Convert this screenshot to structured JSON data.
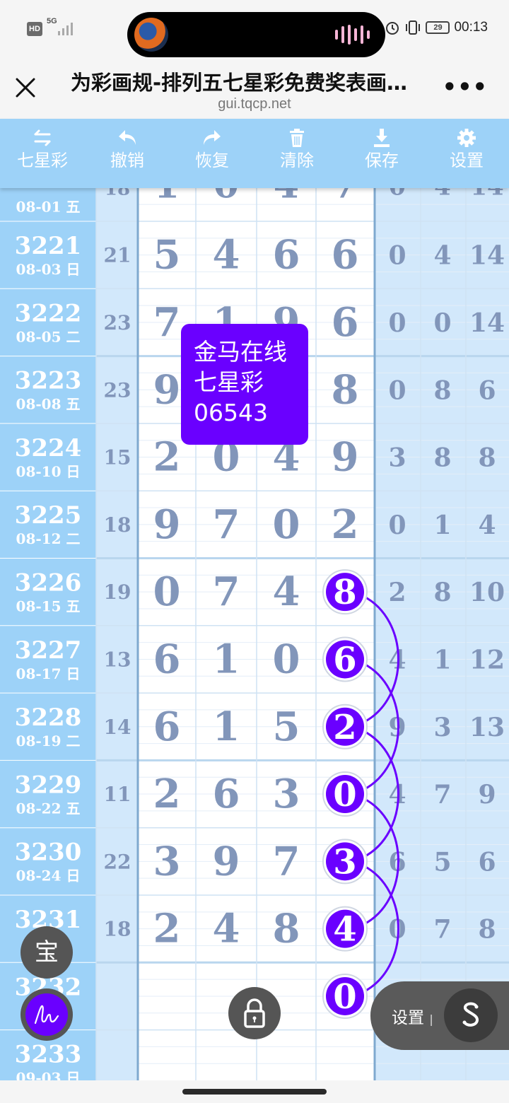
{
  "status_bar": {
    "network_badge": "HD",
    "network_type": "5G",
    "battery": "29",
    "time": "00:13"
  },
  "title_bar": {
    "title": "为彩画规-排列五七星彩免费奖表画…",
    "url": "gui.tqcp.net",
    "more": "•••"
  },
  "toolbar": [
    {
      "label": "七星彩",
      "icon": "swap-icon"
    },
    {
      "label": "撤销",
      "icon": "undo-icon"
    },
    {
      "label": "恢复",
      "icon": "redo-icon"
    },
    {
      "label": "清除",
      "icon": "trash-icon"
    },
    {
      "label": "保存",
      "icon": "download-icon"
    },
    {
      "label": "设置",
      "icon": "gear-icon"
    }
  ],
  "grid": {
    "partial_top": {
      "date": "08-01 五",
      "sum": "18",
      "digits": [
        "1",
        "0",
        "4",
        "7"
      ],
      "right": [
        "0",
        "4",
        "14"
      ]
    },
    "rows": [
      {
        "issue": "3221",
        "date": "08-03 日",
        "sum": "21",
        "digits": [
          "5",
          "4",
          "6",
          "6"
        ],
        "right": [
          "0",
          "4",
          "14"
        ]
      },
      {
        "issue": "3222",
        "date": "08-05 二",
        "sum": "23",
        "digits": [
          "7",
          "1",
          "9",
          "6"
        ],
        "right": [
          "0",
          "0",
          "14"
        ]
      },
      {
        "issue": "3223",
        "date": "08-08 五",
        "sum": "23",
        "digits": [
          "9",
          "",
          "",
          "8"
        ],
        "right": [
          "0",
          "8",
          "6"
        ]
      },
      {
        "issue": "3224",
        "date": "08-10 日",
        "sum": "15",
        "digits": [
          "2",
          "0",
          "4",
          "9"
        ],
        "right": [
          "3",
          "8",
          "8"
        ]
      },
      {
        "issue": "3225",
        "date": "08-12 二",
        "sum": "18",
        "digits": [
          "9",
          "7",
          "0",
          "2"
        ],
        "right": [
          "0",
          "1",
          "4"
        ]
      },
      {
        "issue": "3226",
        "date": "08-15 五",
        "sum": "19",
        "digits": [
          "0",
          "7",
          "4",
          "8"
        ],
        "right": [
          "2",
          "8",
          "10"
        ]
      },
      {
        "issue": "3227",
        "date": "08-17 日",
        "sum": "13",
        "digits": [
          "6",
          "1",
          "0",
          "6"
        ],
        "right": [
          "4",
          "1",
          "12"
        ]
      },
      {
        "issue": "3228",
        "date": "08-19 二",
        "sum": "14",
        "digits": [
          "6",
          "1",
          "5",
          "2"
        ],
        "right": [
          "9",
          "3",
          "13"
        ]
      },
      {
        "issue": "3229",
        "date": "08-22 五",
        "sum": "11",
        "digits": [
          "2",
          "6",
          "3",
          "0"
        ],
        "right": [
          "4",
          "7",
          "9"
        ]
      },
      {
        "issue": "3230",
        "date": "08-24 日",
        "sum": "22",
        "digits": [
          "3",
          "9",
          "7",
          "3"
        ],
        "right": [
          "6",
          "5",
          "6"
        ]
      },
      {
        "issue": "3231",
        "date": "",
        "sum": "18",
        "digits": [
          "2",
          "4",
          "8",
          "4"
        ],
        "right": [
          "0",
          "7",
          "8"
        ]
      },
      {
        "issue": "3232",
        "date": "",
        "sum": "",
        "digits": [
          "",
          "",
          "",
          "0"
        ],
        "right": [
          "",
          "",
          ""
        ]
      },
      {
        "issue": "3233",
        "date": "09-03 日",
        "sum": "",
        "digits": [
          "",
          "",
          "",
          ""
        ],
        "right": [
          "",
          "",
          ""
        ]
      }
    ],
    "highlighted_column": 3,
    "highlighted_rows": [
      5,
      6,
      7,
      8,
      9,
      10,
      11
    ]
  },
  "popup": {
    "line1": "金马在线",
    "line2": "七星彩",
    "line3": "06543"
  },
  "floating": {
    "bao_label": "宝",
    "settings_label": "设置",
    "settings_separator": "|",
    "s_label": "S"
  },
  "colors": {
    "toolbar_bg": "#9dd2f8",
    "left_col_bg": "#9dd2f8",
    "sum_col_bg": "#d2e8fb",
    "right_col_bg": "#d2e8fb",
    "digit_color": "#8296ba",
    "marker_color": "#6a00ff",
    "popup_bg": "#6a00ff"
  }
}
